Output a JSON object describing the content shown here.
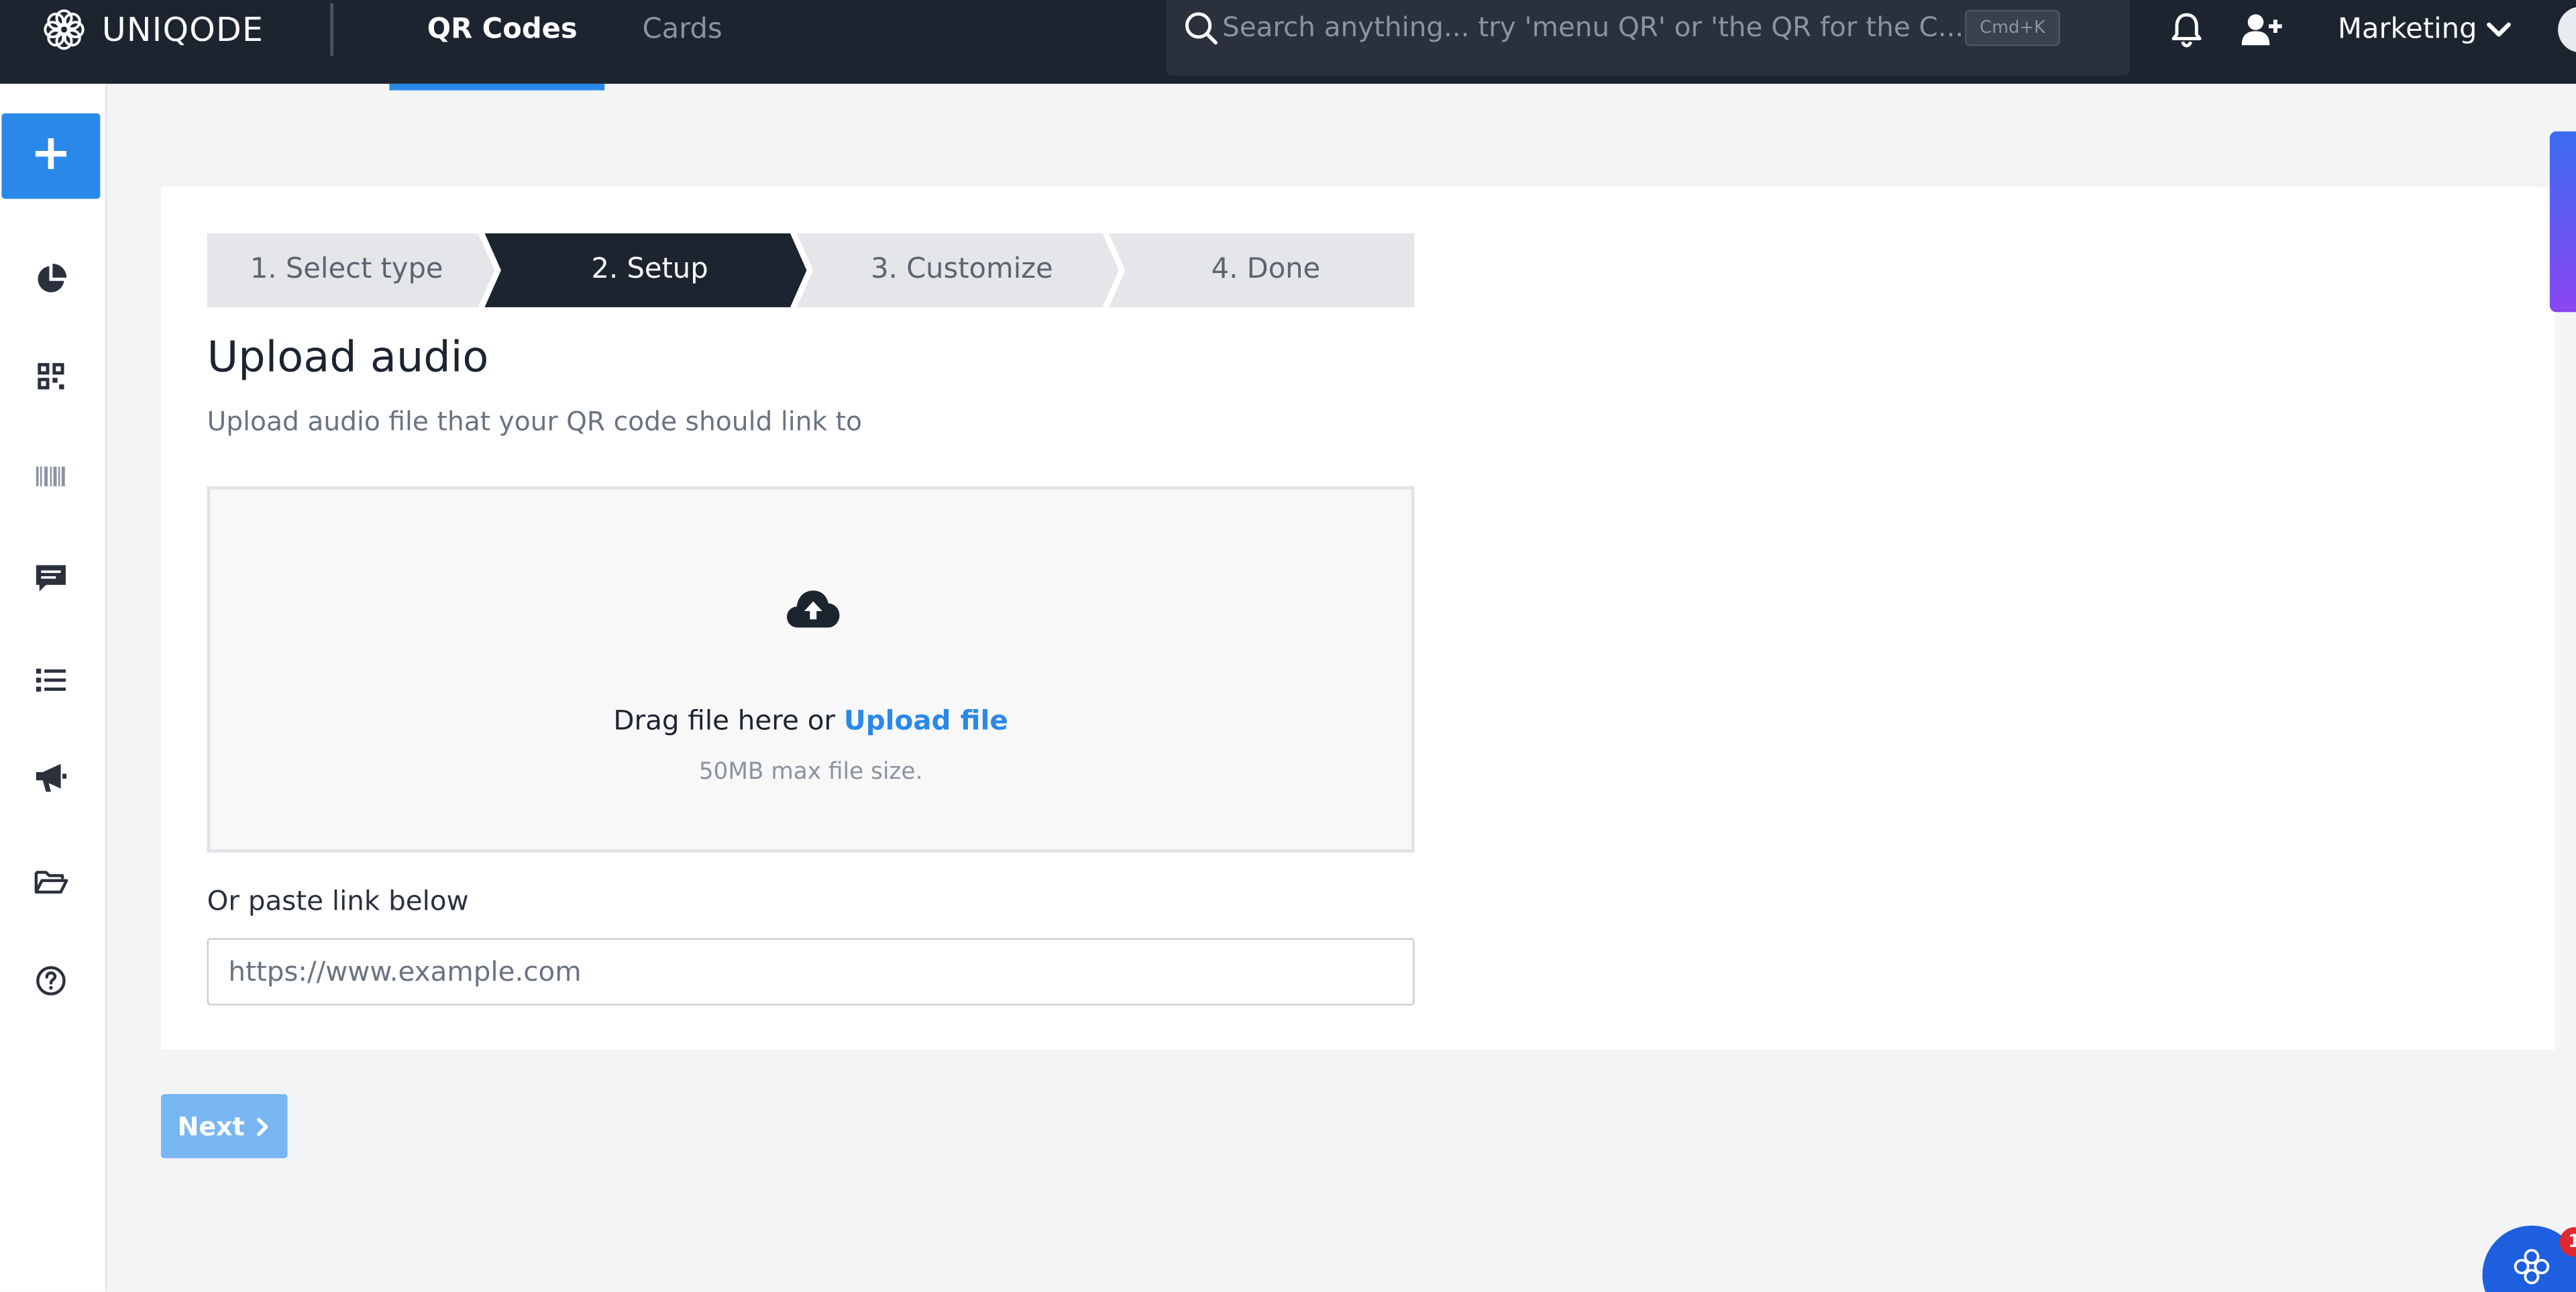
{
  "brand": {
    "name": "UNIQODE"
  },
  "nav": {
    "tabs": [
      {
        "label": "QR Codes",
        "active": true
      },
      {
        "label": "Cards",
        "active": false
      }
    ]
  },
  "search": {
    "placeholder": "Search anything... try 'menu QR' or 'the QR for the C...",
    "shortcut": "Cmd+K"
  },
  "header": {
    "workspace_label": "Marketing",
    "icons": [
      "bell-icon",
      "add-user-icon",
      "chevron-down-icon"
    ]
  },
  "sidebar": {
    "create_label": "+",
    "items": [
      {
        "icon": "analytics-pie-icon"
      },
      {
        "icon": "qr-code-icon"
      },
      {
        "icon": "barcode-icon"
      },
      {
        "icon": "chat-icon"
      },
      {
        "icon": "list-icon"
      },
      {
        "icon": "megaphone-icon"
      },
      {
        "icon": "folder-open-icon"
      },
      {
        "icon": "help-circle-icon"
      }
    ]
  },
  "stepper": {
    "steps": [
      {
        "label": "1. Select type",
        "active": false
      },
      {
        "label": "2. Setup",
        "active": true
      },
      {
        "label": "3. Customize",
        "active": false
      },
      {
        "label": "4. Done",
        "active": false
      }
    ]
  },
  "main": {
    "title": "Upload audio",
    "subtitle": "Upload audio file that your QR code should link to",
    "dropzone": {
      "drag_text": "Drag file here or",
      "upload_link": "Upload file",
      "max_size": "50MB max file size."
    },
    "paste_label": "Or paste link below",
    "link_placeholder": "https://www.example.com",
    "link_value": ""
  },
  "footer": {
    "next_label": "Next"
  },
  "chat": {
    "badge_count": "1"
  },
  "colors": {
    "topbar": "#1c2430",
    "accent": "#2a89e8",
    "next_disabled": "#77b6f3",
    "step_active": "#1c2430",
    "step_inactive": "#e4e6e9"
  }
}
